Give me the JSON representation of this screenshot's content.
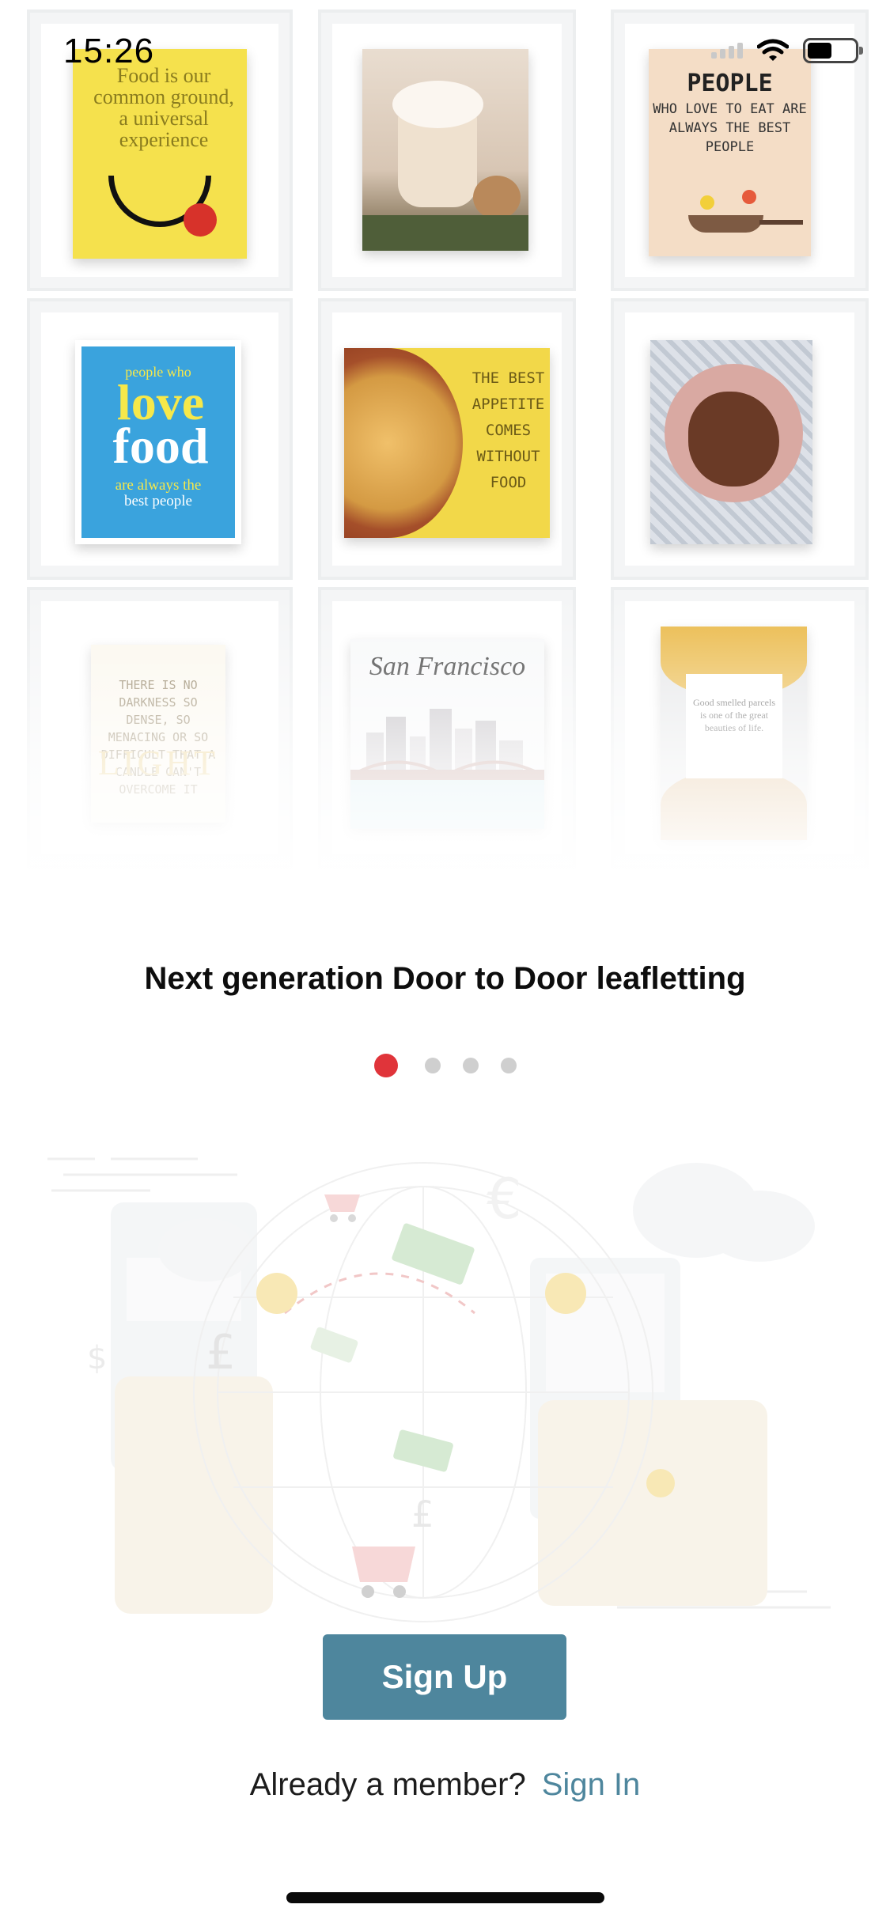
{
  "status_bar": {
    "time": "15:26",
    "icons": [
      "cellular-signal-icon",
      "wifi-icon",
      "battery-icon"
    ]
  },
  "leaflets": [
    {
      "name": "leaflet-food-common-ground",
      "text": "Food is our common ground, a universal experience"
    },
    {
      "name": "leaflet-hot-drink",
      "text": ""
    },
    {
      "name": "leaflet-people-who-love-to-eat",
      "title": "PEOPLE",
      "text": "WHO LOVE TO EAT ARE ALWAYS THE BEST PEOPLE"
    },
    {
      "name": "leaflet-love-food",
      "top": "people who",
      "big1": "love",
      "big2": "food",
      "line1": "are always the",
      "line2": "best people"
    },
    {
      "name": "leaflet-best-appetite",
      "text": "THE BEST APPETITE COMES WITHOUT FOOD"
    },
    {
      "name": "leaflet-chocolate-bowl",
      "text": ""
    },
    {
      "name": "leaflet-light",
      "text": "THERE IS NO DARKNESS SO DENSE, SO MENACING OR SO DIFFICULT THAT A CANDLE CAN'T OVERCOME IT",
      "big": "LIGHT"
    },
    {
      "name": "leaflet-san-francisco",
      "title": "San Francisco"
    },
    {
      "name": "leaflet-food-quote",
      "text": "Good smelled parcels is one of the great beauties of life."
    }
  ],
  "onboarding": {
    "headline": "Next generation Door to Door leafletting",
    "page_count": 4,
    "active_page": 1,
    "accent_color": "#e0343a"
  },
  "illustration": {
    "name": "payments-globe-illustration",
    "icons": [
      "cart-icon",
      "money-icon",
      "euro-icon",
      "pound-icon",
      "dollar-icon",
      "coin-icon",
      "calculator-icon",
      "cloud-icon"
    ]
  },
  "actions": {
    "signup_label": "Sign Up",
    "member_prompt": "Already a member?",
    "signin_label": "Sign In",
    "button_color": "#4e869d"
  }
}
